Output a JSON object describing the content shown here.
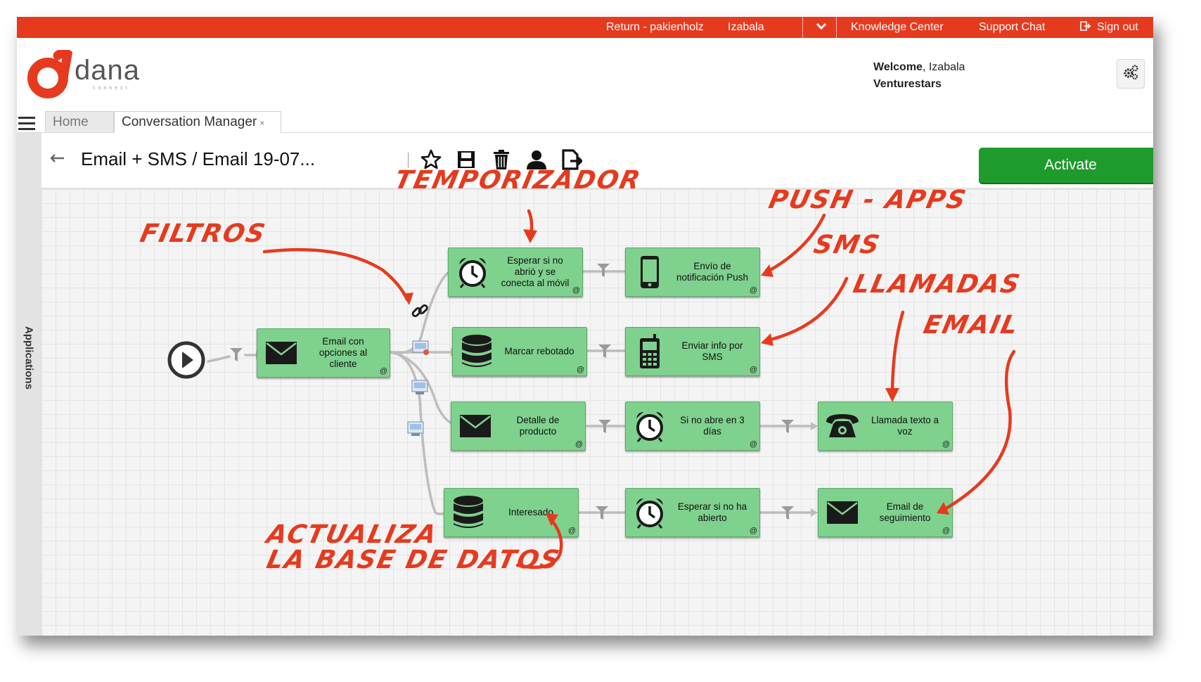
{
  "topbar": {
    "return_label": "Return - pakienholz",
    "user_label": "Izabala",
    "dropdown_icon": "chevron-down-icon",
    "knowledge_label": "Knowledge Center",
    "support_label": "Support Chat",
    "signout_label": "Sign out",
    "color": "#e63a1f"
  },
  "header": {
    "logo_text": "dana",
    "logo_sub": "connect",
    "welcome_bold": "Welcome",
    "welcome_name": ", Izabala",
    "company": "Venturestars"
  },
  "tabs": [
    {
      "label": "Home"
    },
    {
      "label": "Conversation Manager",
      "close": "×"
    }
  ],
  "sidebar": {
    "applications_label": "Applications"
  },
  "toolbar": {
    "title": "Email + SMS / Email 19-07...",
    "icons": [
      "star-icon",
      "save-icon",
      "trash-icon",
      "user-icon",
      "export-icon"
    ],
    "activate_label": "Activate",
    "activate_color": "#1f9a2d"
  },
  "flow": {
    "nodes": [
      {
        "id": "email-opciones",
        "icon": "envelope-icon",
        "label": "Email con\nopciones al\ncliente"
      },
      {
        "id": "esperar-abrio",
        "icon": "alarm-clock-icon",
        "label": "Esperar si no\nabrió y se\nconecta al móvil"
      },
      {
        "id": "push",
        "icon": "mobile-phone-icon",
        "label": "Envío de\nnotificación Push"
      },
      {
        "id": "marcar-rebotado",
        "icon": "database-icon",
        "label": "Marcar rebotado"
      },
      {
        "id": "sms",
        "icon": "cell-phone-icon",
        "label": "Enviar info por\nSMS"
      },
      {
        "id": "detalle-producto",
        "icon": "envelope-icon",
        "label": "Detalle de\nproducto"
      },
      {
        "id": "si-no-abre",
        "icon": "alarm-clock-icon",
        "label": "Si no abre en 3\ndías"
      },
      {
        "id": "llamada",
        "icon": "telephone-icon",
        "label": "Llamada texto a\nvoz"
      },
      {
        "id": "interesado",
        "icon": "database-icon",
        "label": "Interesado"
      },
      {
        "id": "esperar-no-abierto",
        "icon": "alarm-clock-icon",
        "label": "Esperar si no ha\nabierto"
      },
      {
        "id": "email-seguimiento",
        "icon": "envelope-icon",
        "label": "Email de\nseguimiento"
      }
    ],
    "node_color": "#7fd18e",
    "corner_symbol": "@"
  },
  "annotations": {
    "temporizador": "TEMPORIZADOR",
    "filtros": "FILTROS",
    "push_apps": "PUSH - APPS",
    "sms": "SMS",
    "llamadas": "LLAMADAS",
    "email": "EMAIL",
    "actualiza_1": "ACTUALIZA",
    "actualiza_2": "LA BASE DE DATOS",
    "color": "#e63a1f"
  }
}
